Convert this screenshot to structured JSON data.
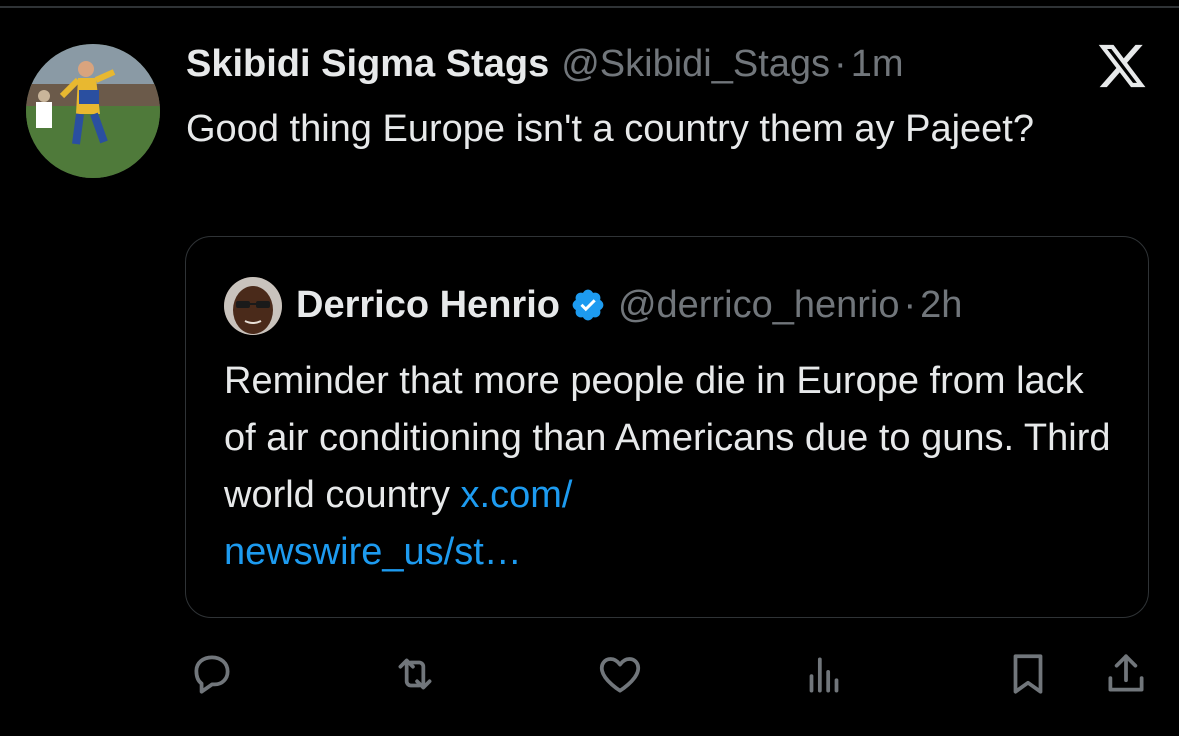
{
  "tweet": {
    "author_name": "Skibidi Sigma Stags",
    "handle": "@Skibidi_Stags",
    "separator": "·",
    "time": "1m",
    "text": "Good thing Europe isn't a country them ay Pajeet?"
  },
  "quote": {
    "author_name": "Derrico Henrio",
    "handle": "@derrico_henrio",
    "separator": "·",
    "time": "2h",
    "text": "Reminder that more people die in Europe from lack of air conditioning than Americans due to guns. Third world country ",
    "link_line1": "x.com/",
    "link_line2": "newswire_us/st…"
  },
  "icons": {
    "brand": "x-logo-icon",
    "verified": "verified-badge-icon",
    "reply": "reply-icon",
    "repost": "repost-icon",
    "like": "like-icon",
    "views": "views-icon",
    "bookmark": "bookmark-icon",
    "share": "share-icon"
  },
  "colors": {
    "background": "#000000",
    "text": "#e7e9ea",
    "secondary": "#71767b",
    "accent": "#1d9bf0",
    "border": "#2f3336"
  }
}
